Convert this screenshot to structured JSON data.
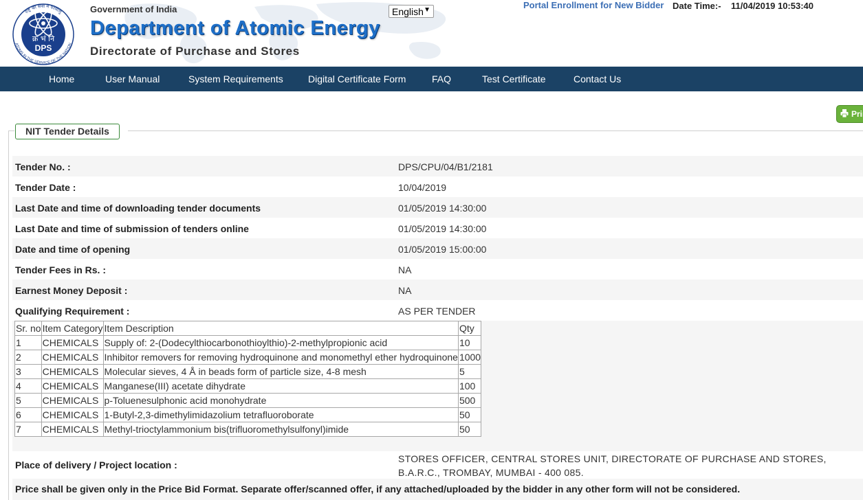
{
  "header": {
    "gov": "Government of India",
    "dept": "Department of Atomic Energy",
    "dir": "Directorate of Purchase and Stores",
    "language": "English",
    "enroll_link": "Portal Enrollment for New Bidder",
    "datetime_label": "Date Time:-",
    "datetime_value": "11/04/2019 10:53:40",
    "logo": {
      "center_text": "DPS",
      "devanagari": "क्र भं नि",
      "ring_top": "राष्ट्र की सेवा में परमाणु",
      "ring_bottom": "ATOMS IN THE SERVICE OF THE NATION"
    }
  },
  "nav": [
    "Home",
    "User Manual",
    "System Requirements",
    "Digital Certificate Form",
    "FAQ",
    "Test Certificate",
    "Contact Us"
  ],
  "print_label": "Print",
  "section_title": "NIT Tender Details",
  "details": [
    {
      "label": "Tender No. :",
      "value": "DPS/CPU/04/B1/2181"
    },
    {
      "label": "Tender Date :",
      "value": "10/04/2019"
    },
    {
      "label": "Last Date and time of downloading tender documents",
      "value": "01/05/2019 14:30:00"
    },
    {
      "label": "Last Date and time of submission of tenders online",
      "value": "01/05/2019 14:30:00"
    },
    {
      "label": "Date and time of opening",
      "value": "01/05/2019 15:00:00"
    },
    {
      "label": "Tender Fees in Rs. :",
      "value": "NA"
    },
    {
      "label": "Earnest Money Deposit :",
      "value": "NA"
    },
    {
      "label": "Qualifying Requirement :",
      "value": "AS PER TENDER"
    }
  ],
  "items_table": {
    "headers": [
      "Sr. no",
      "Item Category",
      "Item Description",
      "Qty"
    ],
    "rows": [
      [
        "1",
        "CHEMICALS",
        "Supply of: 2-(Dodecylthiocarbonothioylthio)-2-methylpropionic acid",
        "10"
      ],
      [
        "2",
        "CHEMICALS",
        "Inhibitor removers for removing hydroquinone and monomethyl ether hydroquinone",
        "1000"
      ],
      [
        "3",
        "CHEMICALS",
        "Molecular sieves, 4 Å in beads form of particle size, 4-8 mesh",
        "5"
      ],
      [
        "4",
        "CHEMICALS",
        "Manganese(III) acetate dihydrate",
        "100"
      ],
      [
        "5",
        "CHEMICALS",
        "p-Toluenesulphonic acid monohydrate",
        "500"
      ],
      [
        "6",
        "CHEMICALS",
        "1-Butyl-2,3-dimethylimidazolium tetrafluoroborate",
        "50"
      ],
      [
        "7",
        "CHEMICALS",
        "Methyl-trioctylammonium bis(trifluoromethylsulfonyl)imide",
        "50"
      ]
    ]
  },
  "delivery": {
    "label": "Place of delivery / Project location :",
    "value": "STORES OFFICER, CENTRAL STORES UNIT, DIRECTORATE OF PURCHASE AND STORES, B.A.R.C., TROMBAY, MUMBAI - 400 085."
  },
  "note": "Price shall be given only in the Price Bid Format. Separate offer/scanned offer, if any attached/uploaded by the bidder in any other form will not be considered.",
  "colors": {
    "nav_bg": "#1b4265",
    "dept_blue": "#1e6fc8",
    "link_blue": "#3c6fb5",
    "print_green": "#6ab23b",
    "legend_border": "#3a8a3a"
  }
}
